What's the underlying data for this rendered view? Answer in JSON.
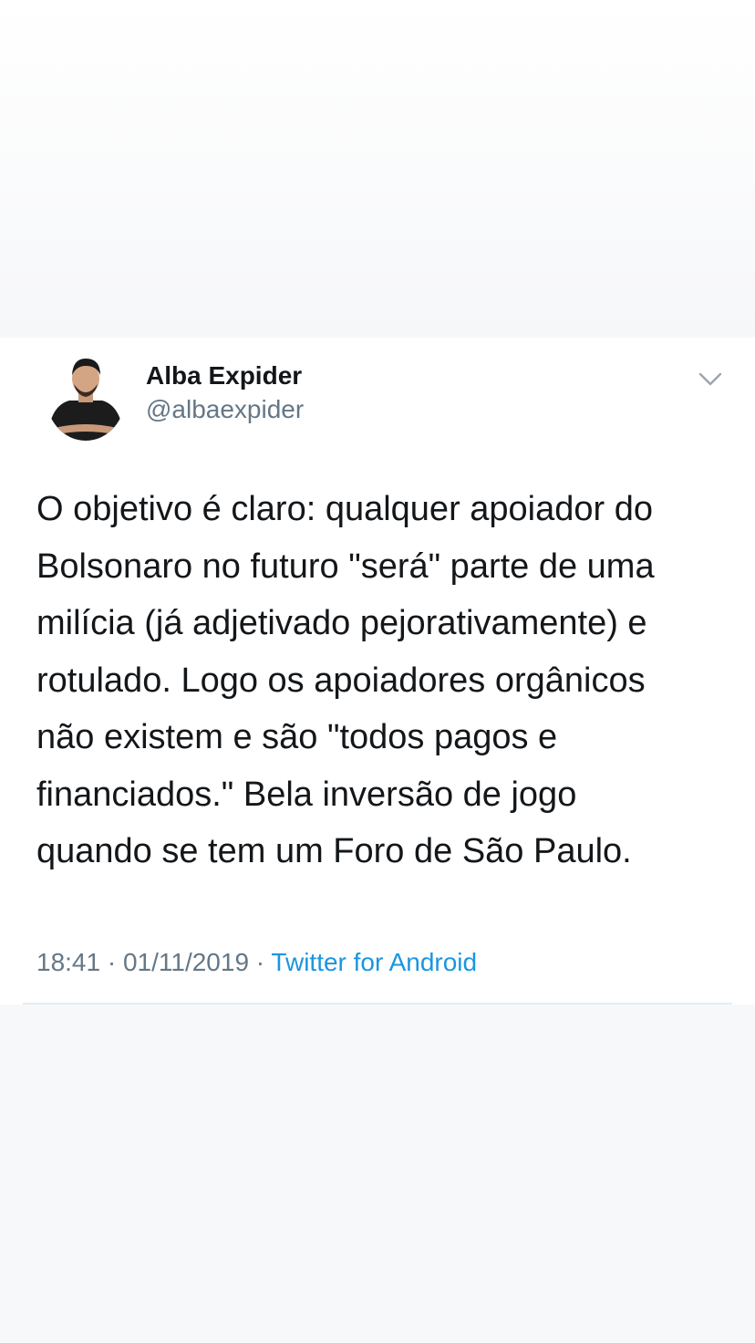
{
  "tweet": {
    "author_name": "Alba Expider",
    "author_handle": "@albaexpider",
    "text_lines": [
      "O objetivo é claro: qualquer apoiador do",
      "Bolsonaro no futuro \"será\" parte de uma",
      "milícia (já adjetivado pejorativamente) e",
      "rotulado. Logo os apoiadores orgânicos",
      "não existem e são \"todos pagos e",
      "financiados.\" Bela inversão de jogo",
      "quando se tem um Foro de São Paulo."
    ],
    "time": "18:41",
    "date": "01/11/2019",
    "separator": " · ",
    "source": "Twitter for Android",
    "menu_icon": "chevron-down-icon"
  },
  "colors": {
    "text": "#14171a",
    "secondary": "#657786",
    "link": "#1b95e0",
    "divider": "#e6ecf0"
  }
}
